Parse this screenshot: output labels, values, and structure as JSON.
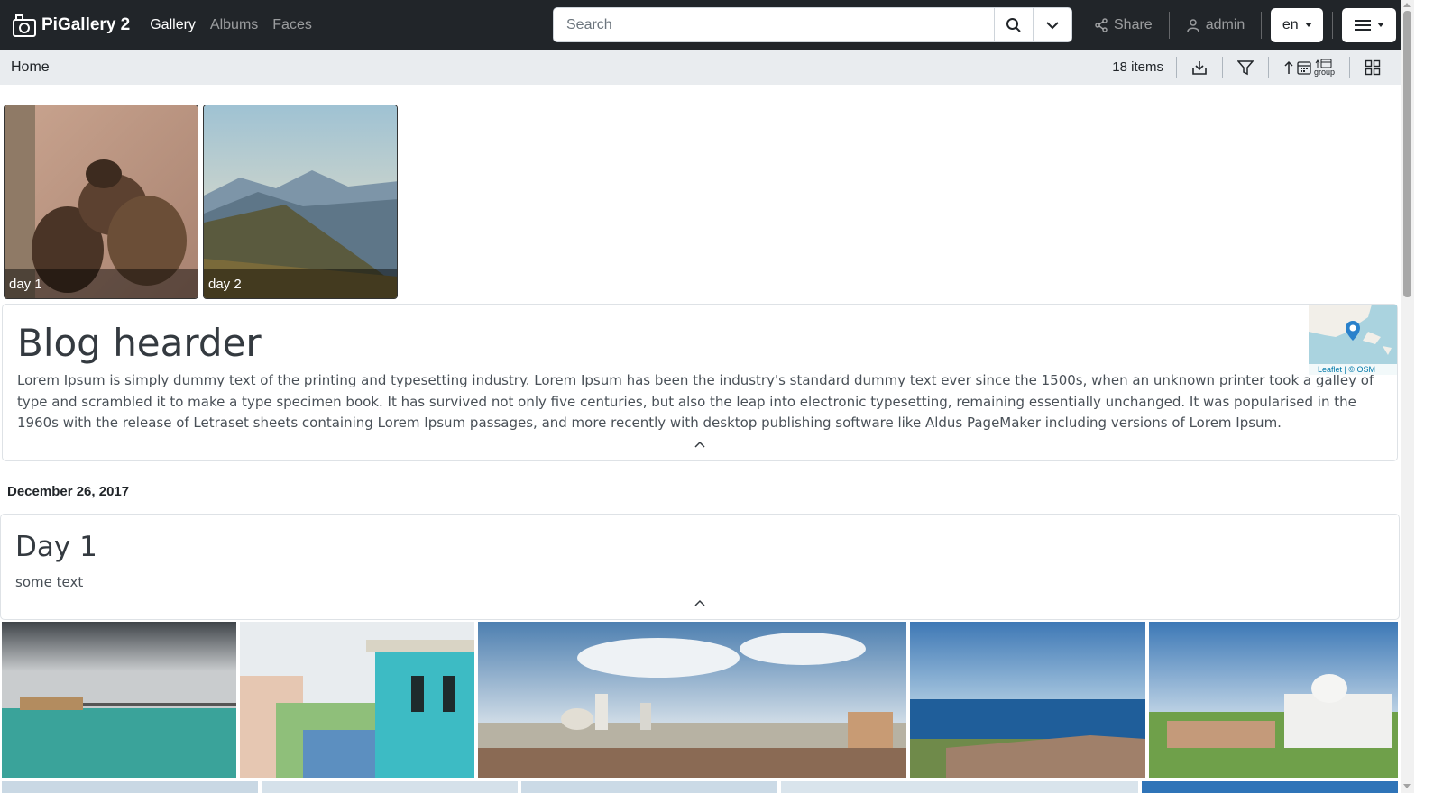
{
  "app": {
    "name": "PiGallery 2"
  },
  "nav": {
    "items": [
      {
        "label": "Gallery",
        "active": true
      },
      {
        "label": "Albums"
      },
      {
        "label": "Faces"
      }
    ]
  },
  "search": {
    "placeholder": "Search",
    "value": ""
  },
  "header_right": {
    "share_label": "Share",
    "user_label": "admin",
    "language": "en"
  },
  "breadcrumb": {
    "home": "Home"
  },
  "toolbar": {
    "items_count": "18 items",
    "group_label": "group"
  },
  "albums": [
    {
      "label": "day 1"
    },
    {
      "label": "day 2"
    }
  ],
  "blog": {
    "title": "Blog hearder",
    "text": "Lorem Ipsum is simply dummy text of the printing and typesetting industry. Lorem Ipsum has been the industry's standard dummy text ever since the 1500s, when an unknown printer took a galley of type and scrambled it to make a type specimen book. It has survived not only five centuries, but also the leap into electronic typesetting, remaining essentially unchanged. It was popularised in the 1960s with the release of Letraset sheets containing Lorem Ipsum passages, and more recently with desktop publishing software like Aldus PageMaker including versions of Lorem Ipsum.",
    "map_attribution": "Leaflet | © OSM"
  },
  "date_group": {
    "date": "December 26, 2017"
  },
  "day": {
    "title": "Day 1",
    "text": "some text"
  },
  "colors": {
    "navbar": "#212529",
    "subbar": "#e9ecef",
    "link_blue": "#0078a8"
  }
}
